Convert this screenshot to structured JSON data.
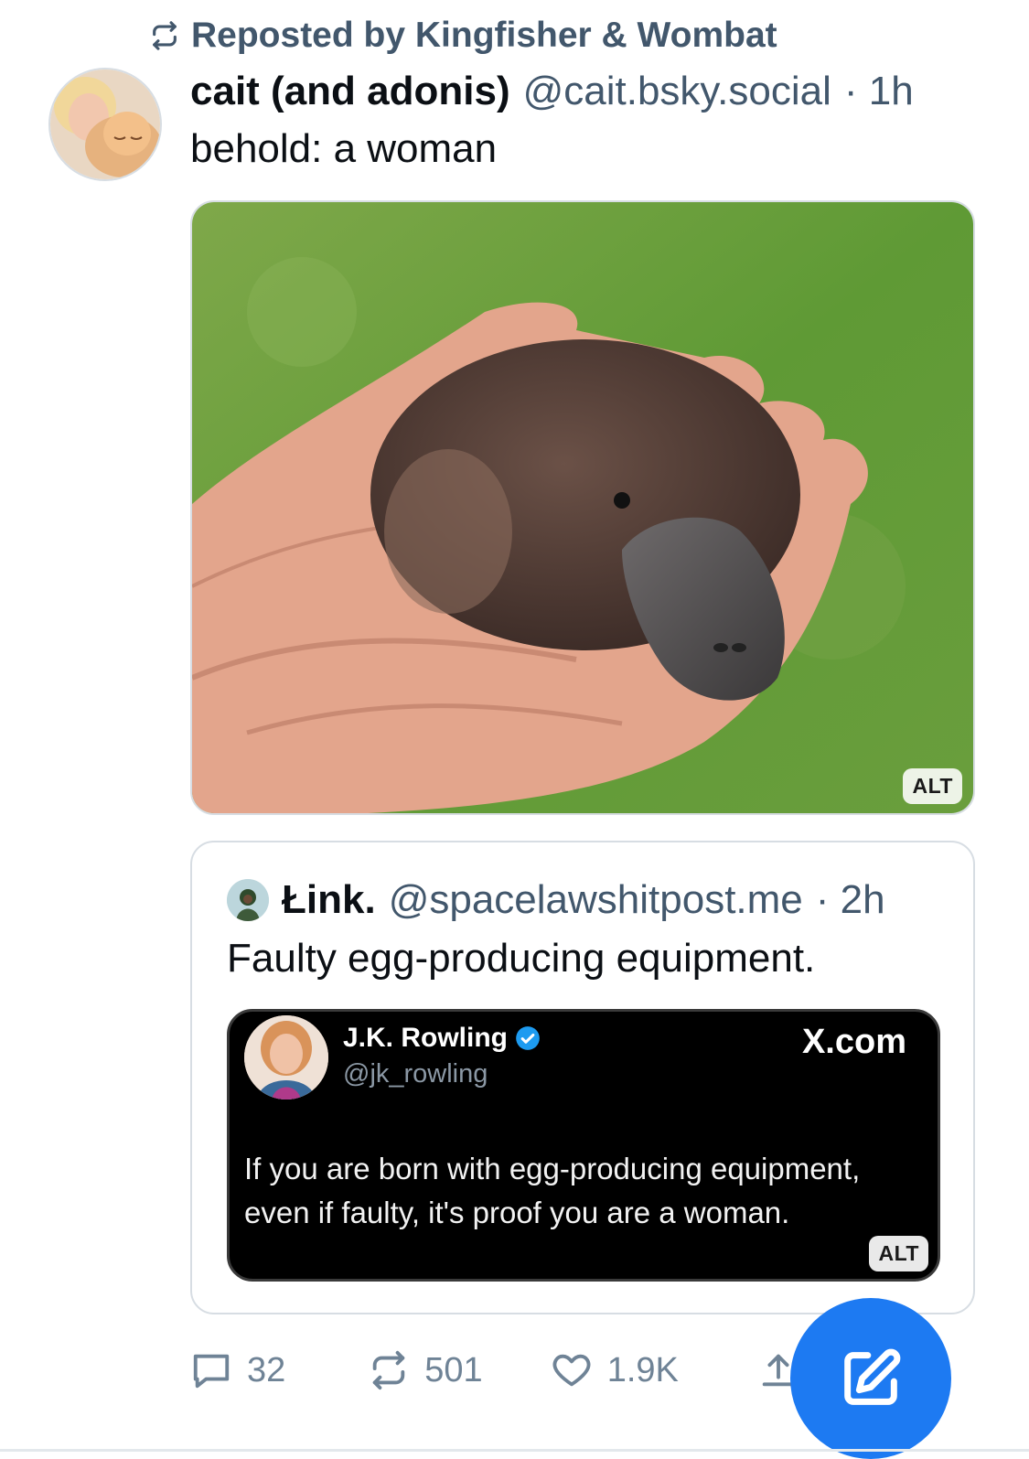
{
  "repost": {
    "icon": "repost-icon",
    "text": "Reposted by Kingfisher & Wombat"
  },
  "post": {
    "author_name": "cait (and adonis)",
    "author_handle": "@cait.bsky.social",
    "time": "· 1h",
    "text": "behold: a woman",
    "image_alt_badge": "ALT"
  },
  "quote": {
    "author_name": "Łink.",
    "author_handle": "@spacelawshitpost.me",
    "time": "· 2h",
    "text": "Faulty egg-producing equipment.",
    "embed": {
      "author_name": "J.K. Rowling",
      "author_handle": "@jk_rowling",
      "brand": "X.com",
      "text": "If you are born with egg-producing equipment, even if faulty, it's proof you are a woman.",
      "alt_badge": "ALT"
    }
  },
  "actions": {
    "replies": "32",
    "reposts": "501",
    "likes": "1.9K"
  },
  "colors": {
    "accent": "#1d7af2",
    "muted": "#42576c",
    "verified": "#1d9bf0"
  }
}
